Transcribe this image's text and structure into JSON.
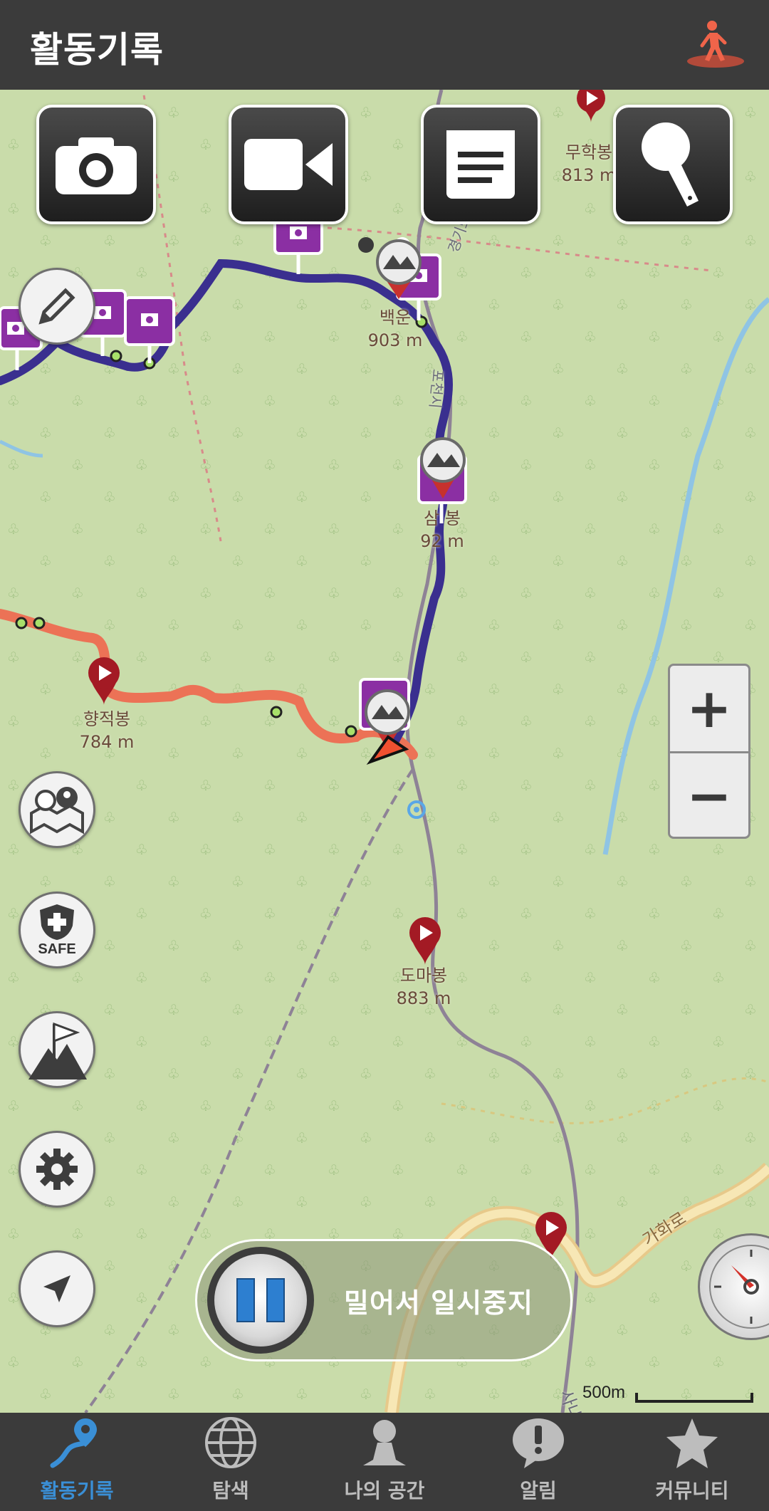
{
  "header": {
    "title": "활동기록",
    "hiker_icon": "hiker-icon"
  },
  "media_buttons": [
    {
      "name": "photo",
      "icon": "camera-icon"
    },
    {
      "name": "video",
      "icon": "video-camera-icon"
    },
    {
      "name": "memo",
      "icon": "memo-icon"
    },
    {
      "name": "voice",
      "icon": "microphone-icon"
    }
  ],
  "map": {
    "peaks": [
      {
        "name": "무학봉",
        "elevation": "813 m"
      },
      {
        "name": "백운",
        "elevation": "903 m"
      },
      {
        "name": "삼",
        "name_suffix": "봉",
        "elevation": "92",
        "elevation_suffix": " m"
      },
      {
        "name": "향적봉",
        "elevation": "784 m"
      },
      {
        "name": "도마봉",
        "elevation": "883 m"
      }
    ],
    "road_labels": [
      "가화로",
      "사내면"
    ],
    "trail_label": "포천시",
    "trail_label_2": "경기도",
    "colors": {
      "track_blue": "#3a2f8f",
      "track_orange": "#ec7256",
      "photo_marker": "#8b2fa3",
      "peak_marker": "#a31a24"
    }
  },
  "zoom": {
    "in": "+",
    "out": "−"
  },
  "side_tools": {
    "safe_label": "SAFE"
  },
  "pause": {
    "label": "밀어서 일시중지"
  },
  "scale": {
    "label": "500m"
  },
  "nav": {
    "items": [
      {
        "label": "활동기록",
        "icon": "route-pin-icon",
        "active": true
      },
      {
        "label": "탐색",
        "icon": "globe-icon",
        "active": false
      },
      {
        "label": "나의 공간",
        "icon": "person-icon",
        "active": false
      },
      {
        "label": "알림",
        "icon": "alert-bubble-icon",
        "active": false
      },
      {
        "label": "커뮤니티",
        "icon": "star-icon",
        "active": false
      }
    ]
  }
}
